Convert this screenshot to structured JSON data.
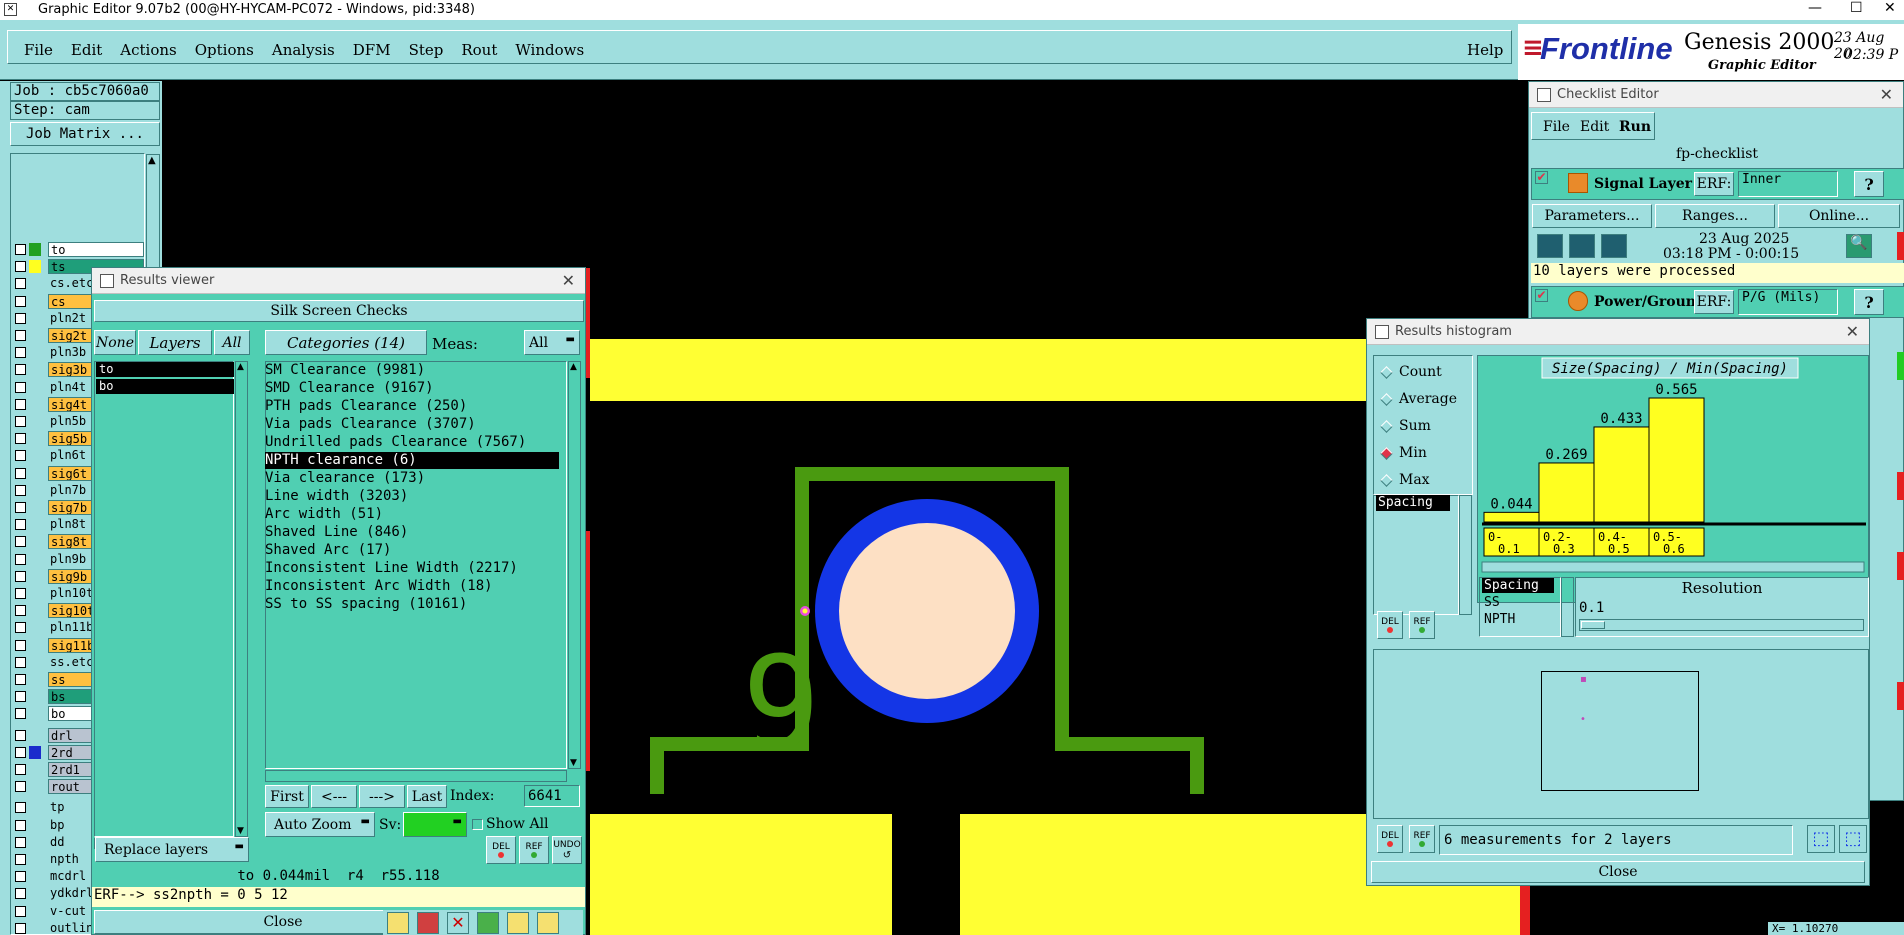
{
  "window": {
    "title": "Graphic Editor 9.07b2 (00@HY-HYCAM-PC072 - Windows, pid:3348)"
  },
  "menu": [
    "File",
    "Edit",
    "Actions",
    "Options",
    "Analysis",
    "DFM",
    "Step",
    "Rout",
    "Windows"
  ],
  "help_label": "Help",
  "brand": {
    "name": "Frontline",
    "product": "Genesis 2000",
    "subtitle": "Graphic Editor",
    "date": "23 Aug 20",
    "time": "02:39 P"
  },
  "job": {
    "job": "Job : cb5c7060a0",
    "step": "Step: cam",
    "matrix_button": "Job Matrix ..."
  },
  "layers": [
    {
      "name": "to",
      "color": "#22a022",
      "bg": "#ffffff"
    },
    {
      "name": "ts",
      "color": "#ffff20",
      "bg": "#1f9e7a"
    },
    {
      "name": "cs.etch",
      "color": "",
      "bg": ""
    },
    {
      "name": "cs",
      "color": "",
      "bg": "#ffc040"
    },
    {
      "name": "pln2t",
      "color": "",
      "bg": ""
    },
    {
      "name": "sig2t",
      "color": "",
      "bg": "#ffc040"
    },
    {
      "name": "pln3b",
      "color": "",
      "bg": ""
    },
    {
      "name": "sig3b",
      "color": "",
      "bg": "#ffc040"
    },
    {
      "name": "pln4t",
      "color": "",
      "bg": ""
    },
    {
      "name": "sig4t",
      "color": "",
      "bg": "#ffc040"
    },
    {
      "name": "pln5b",
      "color": "",
      "bg": ""
    },
    {
      "name": "sig5b",
      "color": "",
      "bg": "#ffc040"
    },
    {
      "name": "pln6t",
      "color": "",
      "bg": ""
    },
    {
      "name": "sig6t",
      "color": "",
      "bg": "#ffc040"
    },
    {
      "name": "pln7b",
      "color": "",
      "bg": ""
    },
    {
      "name": "sig7b",
      "color": "",
      "bg": "#ffc040"
    },
    {
      "name": "pln8t",
      "color": "",
      "bg": ""
    },
    {
      "name": "sig8t",
      "color": "",
      "bg": "#ffc040"
    },
    {
      "name": "pln9b",
      "color": "",
      "bg": ""
    },
    {
      "name": "sig9b",
      "color": "",
      "bg": "#ffc040"
    },
    {
      "name": "pln10t",
      "color": "",
      "bg": ""
    },
    {
      "name": "sig10t",
      "color": "",
      "bg": "#ffc040"
    },
    {
      "name": "pln11b",
      "color": "",
      "bg": ""
    },
    {
      "name": "sig11b",
      "color": "",
      "bg": "#ffc040"
    },
    {
      "name": "ss.etch",
      "color": "",
      "bg": ""
    },
    {
      "name": "ss",
      "color": "",
      "bg": "#ffc040"
    },
    {
      "name": "bs",
      "color": "",
      "bg": "#1f9e7a"
    },
    {
      "name": "bo",
      "color": "",
      "bg": "#ffffff"
    },
    {
      "name": "drl",
      "color": "",
      "bg": "#b9c3d0"
    },
    {
      "name": "2rd",
      "color": "#1a2ccc",
      "bg": "#b9c3d0"
    },
    {
      "name": "2rd1",
      "color": "",
      "bg": "#b9c3d0"
    },
    {
      "name": "rout",
      "color": "",
      "bg": "#b9c3d0"
    },
    {
      "name": "tp",
      "color": "",
      "bg": ""
    },
    {
      "name": "bp",
      "color": "",
      "bg": ""
    },
    {
      "name": "dd",
      "color": "",
      "bg": ""
    },
    {
      "name": "npth",
      "color": "",
      "bg": ""
    },
    {
      "name": "mcdrl",
      "color": "",
      "bg": ""
    },
    {
      "name": "ydkdrl",
      "color": "",
      "bg": ""
    },
    {
      "name": "v-cut",
      "color": "",
      "bg": ""
    },
    {
      "name": "outline",
      "color": "",
      "bg": ""
    }
  ],
  "results_viewer": {
    "title": "Results viewer",
    "header": "Silk Screen Checks",
    "none_label": "None",
    "layers_label": "Layers",
    "all_label": "All",
    "layer_items": [
      "to",
      "bo"
    ],
    "categories_label": "Categories (14)",
    "meas_label": "Meas:",
    "meas_value": "All",
    "categories": [
      "SM Clearance (9981)",
      "SMD Clearance (9167)",
      "PTH pads Clearance (250)",
      "Via pads Clearance (3707)",
      "Undrilled pads Clearance (7567)",
      "NPTH clearance (6)",
      "Via clearance (173)",
      "Line width (3203)",
      "Arc width (51)",
      "Shaved Line (846)",
      "Shaved Arc (17)",
      "Inconsistent Line Width (2217)",
      "Inconsistent Arc Width (18)",
      "SS to SS spacing (10161)"
    ],
    "selected_category": 5,
    "first_label": "First",
    "prev_label": "<---",
    "next_label": "--->",
    "last_label": "Last",
    "index_label": "Index:",
    "index_value": "6641",
    "autozoom_label": "Auto Zoom",
    "sv_label": "Sv:",
    "showall_label": "Show All",
    "replace_label": "Replace layers",
    "del_label": "DEL",
    "ref_label": "REF",
    "undo_label": "UNDO",
    "status": "to 0.044mil  r4  r55.118",
    "erf": "ERF--> ss2npth = 0 5 12",
    "close_label": "Close"
  },
  "checklist": {
    "title": "Checklist Editor",
    "menu": [
      "File",
      "Edit",
      "Run"
    ],
    "name": "fp-checklist",
    "item1": {
      "label": "Signal Layer Ch",
      "erf_label": "ERF:",
      "erf_value": "Inner"
    },
    "parameters_label": "Parameters...",
    "ranges_label": "Ranges...",
    "online_label": "Online...",
    "run_date": "23 Aug 2025",
    "run_time": "03:18 PM - 0:00:15",
    "processed": "10 layers were processed",
    "item2": {
      "label": "Power/Ground C",
      "erf_label": "ERF:",
      "erf_value": "P/G (Mils)"
    },
    "help_q": "?"
  },
  "histogram": {
    "title": "Results histogram",
    "modes": [
      "Count",
      "Average",
      "Sum",
      "Min",
      "Max"
    ],
    "selected_mode": 3,
    "chart_title": "Size(Spacing) / Min(Spacing)",
    "left_list": [
      "Spacing"
    ],
    "measure_list": [
      "Spacing",
      "SS",
      "NPTH"
    ],
    "resolution_label": "Resolution",
    "resolution_value": "0.1",
    "summary": "6 measurements for 2 layers",
    "close_label": "Close",
    "del_label": "DEL",
    "ref_label": "REF"
  },
  "chart_data": {
    "type": "bar",
    "categories": [
      "0-0.1",
      "0.2-0.3",
      "0.4-0.5",
      "0.5-0.6"
    ],
    "values": [
      0.044,
      0.269,
      0.433,
      0.565
    ],
    "title": "Size(Spacing) / Min(Spacing)",
    "ylim": [
      0,
      0.565
    ],
    "grid": false
  },
  "canvas": {
    "label_9": "9",
    "bottom_label": "X= 1.10270"
  }
}
